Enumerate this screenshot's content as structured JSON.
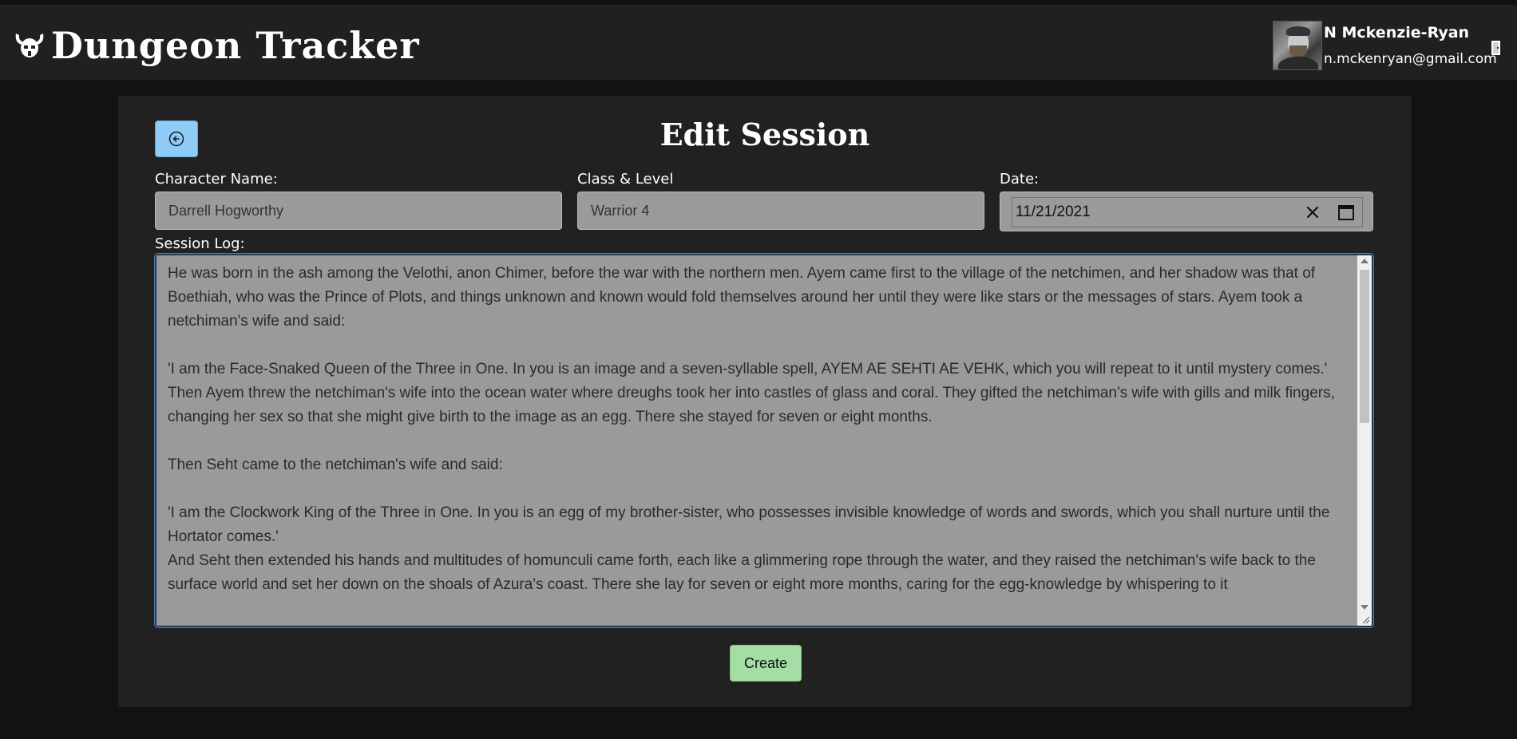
{
  "header": {
    "brand_title": "Dungeon Tracker",
    "user_name": "N Mckenzie-Ryan",
    "user_email": "n.mckenryan@gmail.com"
  },
  "form": {
    "page_title": "Edit Session",
    "character_name_label": "Character Name:",
    "character_name_value": "Darrell Hogworthy",
    "class_level_label": "Class & Level",
    "class_level_value": "Warrior 4",
    "date_label": "Date:",
    "date_value": "11/21/2021",
    "session_log_label": "Session Log:",
    "session_log_value": "He was born in the ash among the Velothi, anon Chimer, before the war with the northern men. Ayem came first to the village of the netchimen, and her shadow was that of Boethiah, who was the Prince of Plots, and things unknown and known would fold themselves around her until they were like stars or the messages of stars. Ayem took a netchiman's wife and said:\n\n'I am the Face-Snaked Queen of the Three in One. In you is an image and a seven-syllable spell, AYEM AE SEHTI AE VEHK, which you will repeat to it until mystery comes.'\nThen Ayem threw the netchiman's wife into the ocean water where dreughs took her into castles of glass and coral. They gifted the netchiman's wife with gills and milk fingers, changing her sex so that she might give birth to the image as an egg. There she stayed for seven or eight months.\n\nThen Seht came to the netchiman's wife and said:\n\n'I am the Clockwork King of the Three in One. In you is an egg of my brother-sister, who possesses invisible knowledge of words and swords, which you shall nurture until the Hortator comes.'\nAnd Seht then extended his hands and multitudes of homunculi came forth, each like a glimmering rope through the water, and they raised the netchiman's wife back to the surface world and set her down on the shoals of Azura's coast. There she lay for seven or eight more months, caring for the egg-knowledge by whispering to it",
    "create_label": "Create"
  },
  "colors": {
    "back_button": "#8ecbf6",
    "create_button": "#a5dea5",
    "field_bg": "#9a9a9a",
    "topbar_bg": "#202020",
    "card_bg": "#212121"
  },
  "icons": {
    "brand": "horned-helmet-icon",
    "back": "circle-arrow-left-icon",
    "logout": "door-icon",
    "date_clear": "close-icon",
    "date_picker": "calendar-icon"
  }
}
